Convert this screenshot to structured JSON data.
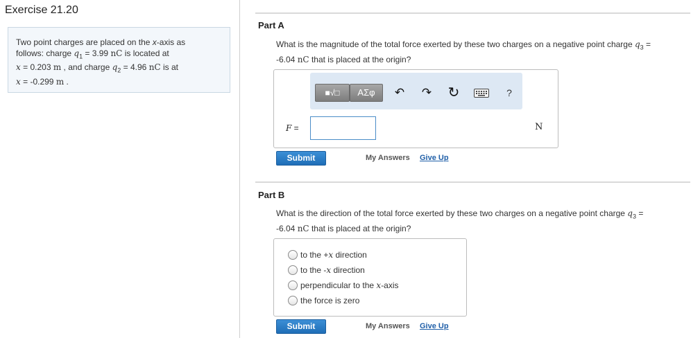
{
  "exercise": {
    "title": "Exercise 21.20"
  },
  "problem": {
    "t1": "Two point charges are placed on the ",
    "x_axis_italic": "x",
    "t2": "-axis as",
    "t3": "follows: charge ",
    "q1_sym": "q",
    "q1_sub": "1",
    "q1_val": " = 3.99 ",
    "unit_nC": "nC",
    "t4": " is located at",
    "x1_sym": "x",
    "x1_eq": " = 0.203 ",
    "unit_m": "m",
    "t5": " , and charge ",
    "q2_sym": "q",
    "q2_sub": "2",
    "q2_val": " = 4.96 ",
    "t6": " is at",
    "x2_sym": "x",
    "x2_eq": " = -0.299 ",
    "t7": " ."
  },
  "part_a": {
    "title": "Part A",
    "q_t1": "What is the magnitude of the total force exerted by these two charges on a negative point charge ",
    "q3_sym": "q",
    "q3_sub": "3",
    "q_eq": " =",
    "q_t2": "-6.04 ",
    "unit_nC": "nC",
    "q_t3": " that is placed at the origin?",
    "toolbar": {
      "templates_label": "■√□",
      "symbols_label": "ΑΣφ",
      "undo_icon": "↶",
      "redo_icon": "↷",
      "reset_icon": "↻",
      "keyboard_icon": "keyboard",
      "help_label": "?"
    },
    "input_label": "F",
    "input_eq": " =",
    "input_value": "",
    "unit": "N",
    "submit_label": "Submit",
    "my_answers_label": "My Answers",
    "give_up_label": "Give Up"
  },
  "part_b": {
    "title": "Part B",
    "q_t1": "What is the direction of the total force exerted by these two charges on a negative point charge ",
    "q3_sym": "q",
    "q3_sub": "3",
    "q_eq": " =",
    "q_t2": "-6.04 ",
    "unit_nC": "nC",
    "q_t3": " that is placed at the origin?",
    "options": [
      {
        "pre": "to the +",
        "sym": "x",
        "post": " direction"
      },
      {
        "pre": "to the -",
        "sym": "x",
        "post": " direction"
      },
      {
        "pre": "perpendicular to the ",
        "sym": "x",
        "post": "-axis"
      },
      {
        "pre": "the force is zero",
        "sym": "",
        "post": ""
      }
    ],
    "submit_label": "Submit",
    "my_answers_label": "My Answers",
    "give_up_label": "Give Up"
  },
  "colors": {
    "accent": "#1f6eb7",
    "link": "#1f5fa8",
    "toolbar_bg": "#dde8f4",
    "problem_bg": "#f3f7fb"
  }
}
